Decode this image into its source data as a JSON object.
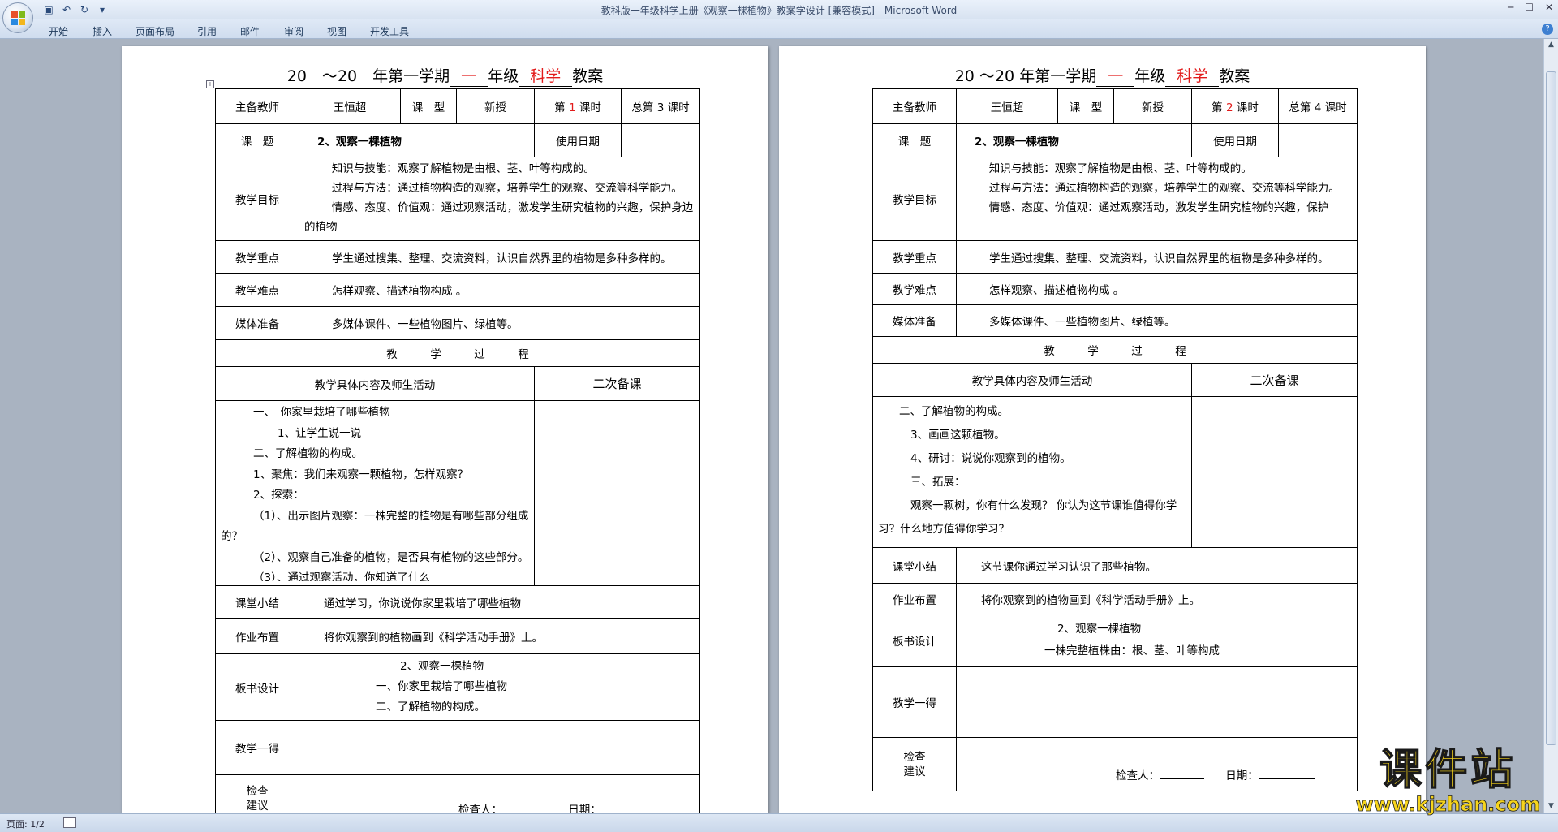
{
  "window": {
    "title": "教科版一年级科学上册《观察一棵植物》教案学设计 [兼容模式] - Microsoft Word"
  },
  "ribbon": {
    "tabs": [
      "开始",
      "插入",
      "页面布局",
      "引用",
      "邮件",
      "审阅",
      "视图",
      "开发工具"
    ]
  },
  "status": {
    "page": "页面: 1/2"
  },
  "watermark": {
    "text": "课件站",
    "url": "www.kjzhan.com"
  },
  "page1": {
    "heading": {
      "year1": "20",
      "year2": "～20",
      "sem": "年第一学期",
      "grade": "一",
      "grade_lbl": "年级",
      "subject": "科学",
      "plan": "教案"
    },
    "r1": {
      "l_teacher": "主备教师",
      "teacher": "王恒超",
      "l_type": "课　型",
      "type": "新授",
      "lesson_pre": "第",
      "lesson_no": "1",
      "lesson_post": "课时",
      "total_pre": "总第",
      "total_no": "3",
      "total_post": "课时"
    },
    "r2": {
      "l_topic": "课　题",
      "topic": "2、观察一棵植物",
      "l_date": "使用日期"
    },
    "goals": {
      "label": "教学目标",
      "g1": "知识与技能：观察了解植物是由根、茎、叶等构成的。",
      "g2": "过程与方法：通过植物构造的观察，培养学生的观察、交流等科学能力。",
      "g3": "情感、态度、价值观：通过观察活动，激发学生研究植物的兴趣，保护身边的植物"
    },
    "key": {
      "label": "教学重点",
      "text": "学生通过搜集、整理、交流资料，认识自然界里的植物是多种多样的。"
    },
    "diff": {
      "label": "教学难点",
      "text": "怎样观察、描述植物构成 。"
    },
    "media": {
      "label": "媒体准备",
      "text": "多媒体课件、一些植物图片、绿植等。"
    },
    "process_title": "教　　　学　　　过　　　程",
    "content_header": "教学具体内容及师生活动",
    "second_header": "二次备课",
    "steps": [
      "一、　你家里栽培了哪些植物",
      "1、让学生说一说",
      "二、了解植物的构成。",
      "1、聚焦：我们来观察一颗植物，怎样观察？",
      "2、探索：",
      "（1）、出示图片观察：一株完整的植物是有哪些部分组成的？",
      "（2）、观察自己准备的植物，是否具有植物的这些部分。",
      "（3）、通过观察活动，你知道了什么"
    ],
    "summary": {
      "label": "课堂小结",
      "text": "通过学习，你说说你家里栽培了哪些植物"
    },
    "homework": {
      "label": "作业布置",
      "text": "将你观察到的植物画到《科学活动手册》上。"
    },
    "board": {
      "label": "板书设计",
      "l1": "2、观察一棵植物",
      "l2": "一、你家里栽培了哪些植物",
      "l3": "二、了解植物的构成。"
    },
    "reflect": {
      "label": "教学一得"
    },
    "check": {
      "label1": "检查",
      "label2": "建议",
      "checker": "检查人：",
      "date": "日期："
    }
  },
  "page2": {
    "heading": {
      "year1": "20",
      "year2": "～20",
      "sem": "年第一学期",
      "grade": "一",
      "grade_lbl": "年级",
      "subject": "科学",
      "plan": "教案"
    },
    "r1": {
      "l_teacher": "主备教师",
      "teacher": "王恒超",
      "l_type": "课　型",
      "type": "新授",
      "lesson_pre": "第",
      "lesson_no": "2",
      "lesson_post": "课时",
      "total_pre": "总第",
      "total_no": "4",
      "total_post": "课时"
    },
    "r2": {
      "l_topic": "课　题",
      "topic": "2、观察一棵植物",
      "l_date": "使用日期"
    },
    "goals": {
      "label": "教学目标",
      "g1": "知识与技能：观察了解植物是由根、茎、叶等构成的。",
      "g2": "过程与方法：通过植物构造的观察，培养学生的观察、交流等科学能力。",
      "g3": "情感、态度、价值观：通过观察活动，激发学生研究植物的兴趣，保护"
    },
    "key": {
      "label": "教学重点",
      "text": "学生通过搜集、整理、交流资料，认识自然界里的植物是多种多样的。"
    },
    "diff": {
      "label": "教学难点",
      "text": "怎样观察、描述植物构成 。"
    },
    "media": {
      "label": "媒体准备",
      "text": "多媒体课件、一些植物图片、绿植等。"
    },
    "process_title": "教　　　学　　　过　　　程",
    "content_header": "教学具体内容及师生活动",
    "second_header": "二次备课",
    "steps": [
      "二、了解植物的构成。",
      "3、画画这颗植物。",
      "4、研讨：说说你观察到的植物。",
      "三、拓展：",
      "观察一颗树，你有什么发现？ 你认为这节课谁值得你学习？什么地方值得你学习？"
    ],
    "summary": {
      "label": "课堂小结",
      "text": "这节课你通过学习认识了那些植物。"
    },
    "homework": {
      "label": "作业布置",
      "text": "将你观察到的植物画到《科学活动手册》上。"
    },
    "board": {
      "label": "板书设计",
      "l1": "2、观察一棵植物",
      "l2": "一株完整植株由：根、茎、叶等构成"
    },
    "reflect": {
      "label": "教学一得"
    },
    "check": {
      "label1": "检查",
      "label2": "建议",
      "checker": "检查人：",
      "date": "日期："
    }
  }
}
